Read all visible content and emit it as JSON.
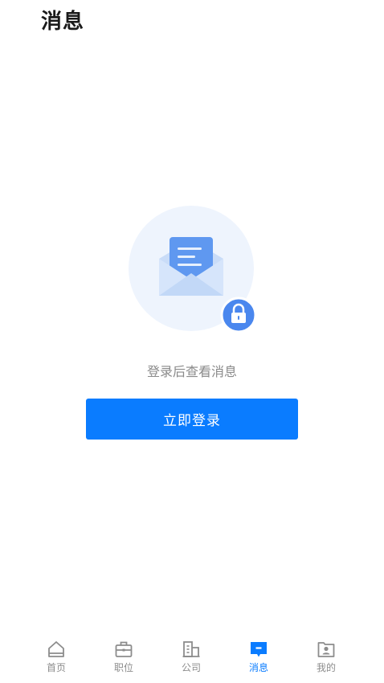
{
  "header": {
    "title": "消息"
  },
  "empty_state": {
    "illustration_icon": "locked-envelope-icon",
    "message": "登录后查看消息",
    "button_label": "立即登录"
  },
  "tabbar": {
    "items": [
      {
        "label": "首页",
        "icon": "home-icon",
        "active": false
      },
      {
        "label": "职位",
        "icon": "briefcase-icon",
        "active": false
      },
      {
        "label": "公司",
        "icon": "building-icon",
        "active": false
      },
      {
        "label": "消息",
        "icon": "message-icon",
        "active": true
      },
      {
        "label": "我的",
        "icon": "profile-icon",
        "active": false
      }
    ]
  },
  "colors": {
    "accent": "#0a7cff",
    "inactive_tab": "#8c8c8c",
    "illustration_circle": "#eef4fd",
    "envelope": "#c9dcf8",
    "letter": "#5f98f0",
    "lock_badge": "#4a87ee"
  }
}
